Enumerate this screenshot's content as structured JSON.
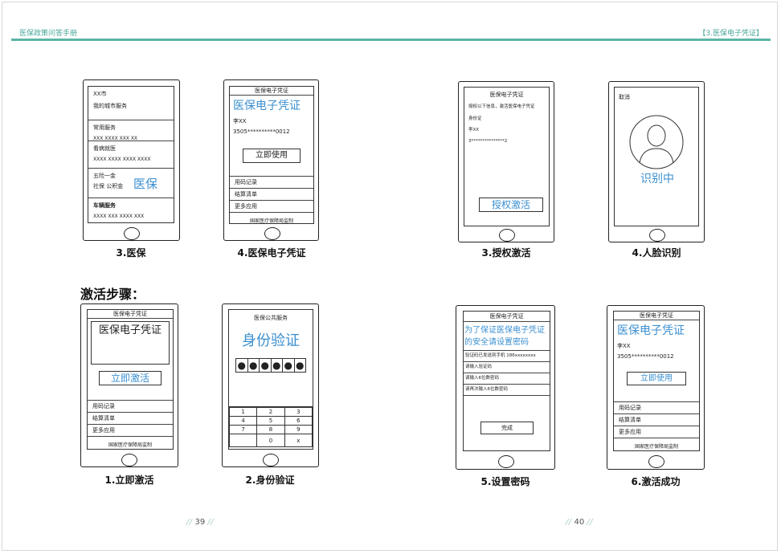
{
  "header": {
    "left": "医保政策问答手册",
    "right": "【3.医保电子凭证】"
  },
  "steps_title": "激活步骤：",
  "page_left": "39",
  "page_right": "40",
  "colors": {
    "accent": "#5bb5a5",
    "blue": "#3a8fd0"
  },
  "screens": {
    "s3": {
      "caption": "3.医保",
      "city": "XX市",
      "my_city_service": "我的城市服务",
      "common_service": "常用服务",
      "common_items": "XXX   XXXX   XXX   XX",
      "see_doctor": "看病就医",
      "see_doctor_items": "XXXX  XXXX  XXXX  XXXX",
      "insurance": "五险一金",
      "insurance_items": "社保  公积金",
      "yibao": "医保",
      "vehicle": "车辆服务",
      "vehicle_items": "XXXX  XXX  XXXX  XXX"
    },
    "s4": {
      "caption": "4.医保电子凭证",
      "top": "医保电子凭证",
      "big": "医保电子凭证",
      "name": "李XX",
      "id": "3505**********0012",
      "btn": "立即使用",
      "menu": [
        "用码记录",
        "结算清单",
        "更多应用"
      ],
      "footer": "国家医疗保障局监制"
    },
    "s3b": {
      "caption": "3.授权激活",
      "title": "医保电子凭证",
      "desc": "授权以下信息，激活医保电子凭证",
      "id_label": "身份证",
      "name": "李XX",
      "id": "3***************2",
      "btn": "授权激活"
    },
    "s4b": {
      "caption": "4.人脸识别",
      "cancel": "取消",
      "status": "识别中"
    },
    "s1": {
      "caption": "1.立即激活",
      "top": "医保电子凭证",
      "big": "医保电子凭证",
      "btn": "立即激活",
      "menu": [
        "用码记录",
        "结算清单",
        "更多应用"
      ],
      "footer": "国家医疗保障局监制"
    },
    "s2": {
      "caption": "2.身份验证",
      "top": "医保公共服务",
      "big": "身份验证",
      "pin": [
        "●",
        "●",
        "●",
        "●",
        "●",
        "●"
      ],
      "keys": [
        [
          "1",
          "2",
          "3"
        ],
        [
          "4",
          "5",
          "6"
        ],
        [
          "7",
          "8",
          "9"
        ],
        [
          "",
          "0",
          "x"
        ]
      ]
    },
    "s5": {
      "caption": "5.设置密码",
      "title": "医保电子凭证",
      "blue1": "为了保证医保电子凭证",
      "blue2": "的安全请设置密码",
      "rows": [
        "验证码已发送到手机 186xxxxxxxx",
        "请输入验证码",
        "请输入6位数密码",
        "请再次输入6位数密码"
      ],
      "btn": "完成"
    },
    "s6": {
      "caption": "6.激活成功",
      "top": "医保电子凭证",
      "big": "医保电子凭证",
      "name": "李XX",
      "id": "3505**********0012",
      "btn": "立即使用",
      "menu": [
        "用码记录",
        "结算清单",
        "更多应用"
      ],
      "footer": "国家医疗保障局监制"
    }
  }
}
